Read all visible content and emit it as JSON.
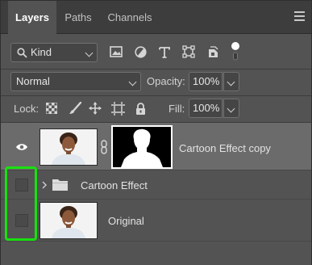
{
  "tabs": [
    "Layers",
    "Paths",
    "Channels"
  ],
  "filter": {
    "kind_label": "Kind"
  },
  "blend": {
    "mode": "Normal",
    "opacity_label": "Opacity:",
    "opacity_value": "100%"
  },
  "lock": {
    "label": "Lock:",
    "fill_label": "Fill:",
    "fill_value": "100%"
  },
  "layers": [
    {
      "name": "Cartoon Effect copy"
    },
    {
      "name": "Cartoon Effect"
    },
    {
      "name": "Original"
    }
  ],
  "colors": {
    "highlight": "#19e00f",
    "panel": "#535353",
    "selected_row": "#6b6b6b"
  }
}
